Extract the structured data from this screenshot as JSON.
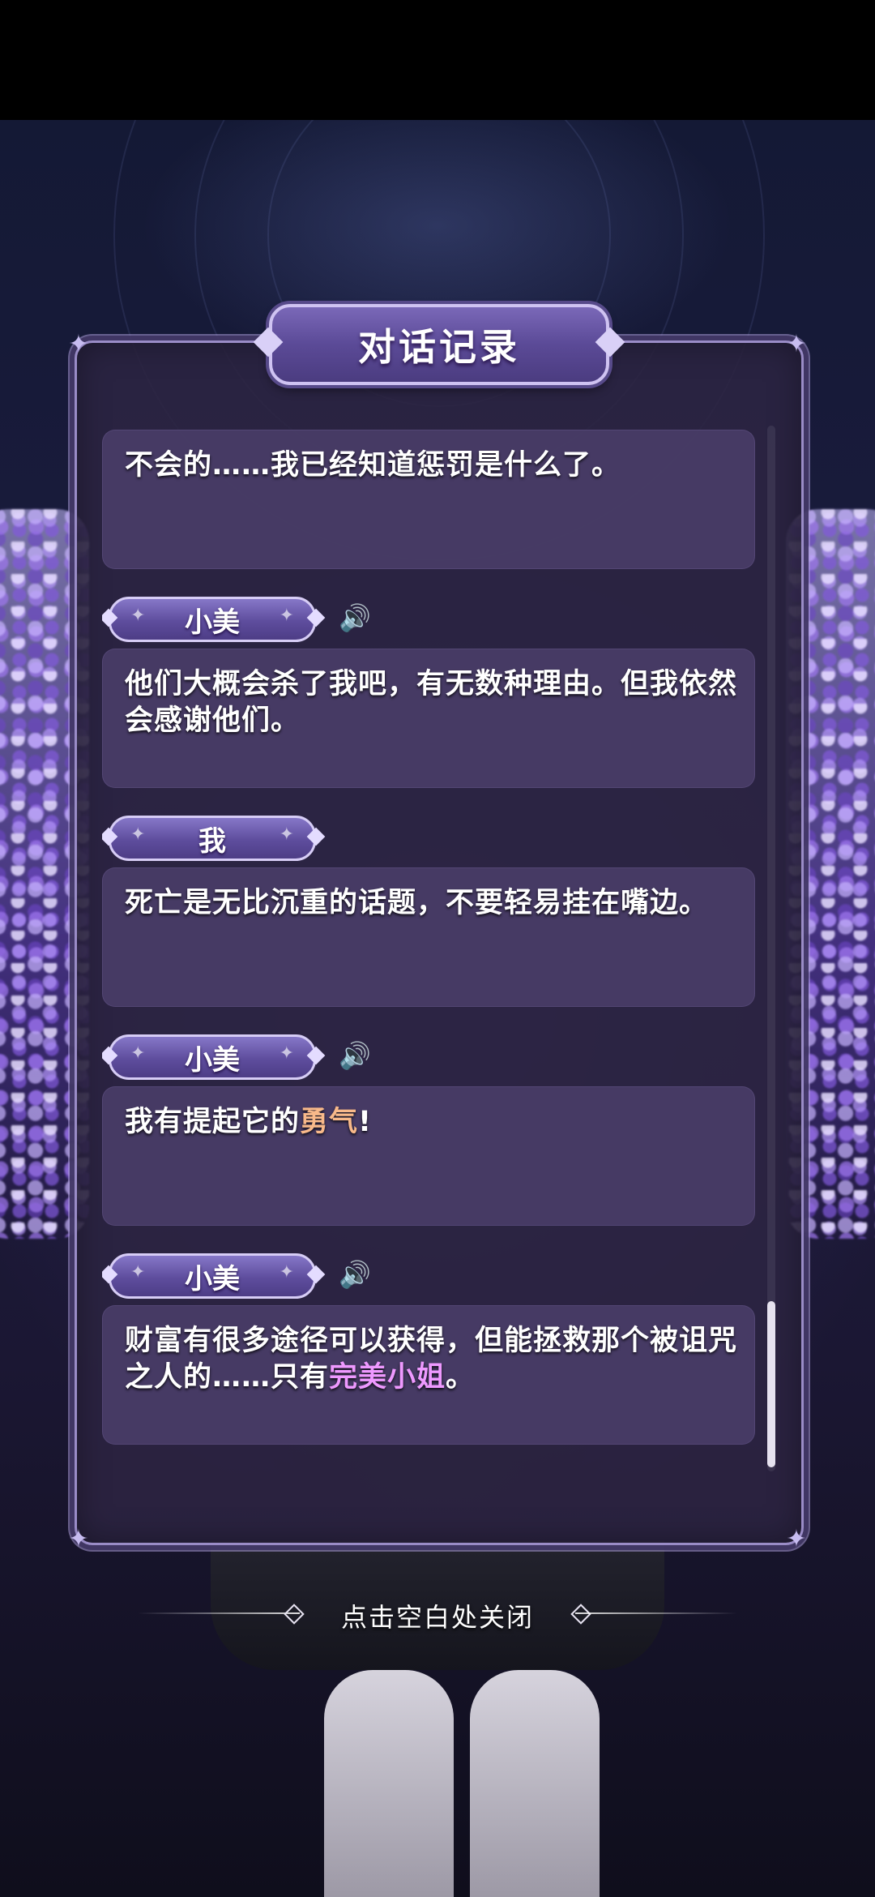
{
  "title": "对话记录",
  "log": {
    "entries": [
      {
        "speaker": "",
        "voice": false,
        "segments": [
          {
            "text": "不会的……我已经知道惩罚是什么了。",
            "hl": ""
          }
        ]
      },
      {
        "speaker": "小美",
        "voice": true,
        "segments": [
          {
            "text": "他们大概会杀了我吧，有无数种理由。但我依然会感谢他们。",
            "hl": ""
          }
        ]
      },
      {
        "speaker": "我",
        "voice": false,
        "segments": [
          {
            "text": "死亡是无比沉重的话题，不要轻易挂在嘴边。",
            "hl": ""
          }
        ]
      },
      {
        "speaker": "小美",
        "voice": true,
        "segments": [
          {
            "text": "我有提起它的",
            "hl": ""
          },
          {
            "text": "勇气",
            "hl": "orange"
          },
          {
            "text": "!",
            "hl": ""
          }
        ]
      },
      {
        "speaker": "小美",
        "voice": true,
        "segments": [
          {
            "text": "财富有很多途径可以获得，但能拯救那个被诅咒之人的……只有",
            "hl": ""
          },
          {
            "text": "完美小姐",
            "hl": "pink"
          },
          {
            "text": "。",
            "hl": ""
          }
        ]
      }
    ]
  },
  "close_hint": "点击空白处关闭",
  "icons": {
    "voice": "speaker-icon",
    "corner": "ornament-icon",
    "sparkle": "sparkle-icon"
  },
  "colors": {
    "highlight_orange": "#f8b98a",
    "highlight_pink": "#ee99ff",
    "panel": "#2c2442"
  }
}
